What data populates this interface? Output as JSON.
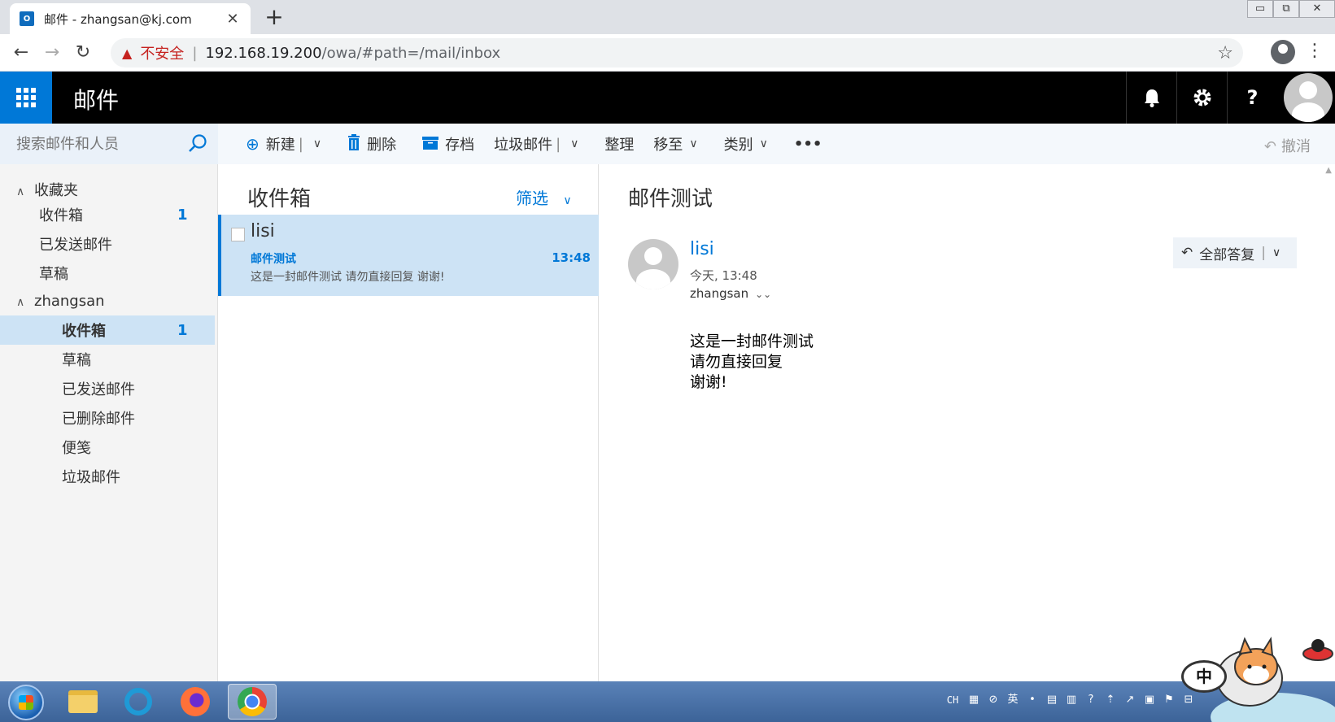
{
  "browser": {
    "tab_title": "邮件 - zhangsan@kj.com",
    "tab_favicon": "O",
    "new_tab": "+",
    "window_controls": [
      "▭",
      "⧉",
      "✕"
    ],
    "security_label": "不安全",
    "url_host": "192.168.19.200",
    "url_path": "/owa/#path=/mail/inbox"
  },
  "header": {
    "app_title": "邮件",
    "icons": [
      "bell-icon",
      "gear-icon",
      "help-icon",
      "avatar"
    ],
    "help_glyph": "?"
  },
  "search": {
    "placeholder": "搜索邮件和人员"
  },
  "commands": {
    "new": "新建",
    "delete": "删除",
    "archive": "存档",
    "junk": "垃圾邮件",
    "sweep": "整理",
    "move": "移至",
    "categorize": "类别",
    "more": "•••",
    "undo": "撤消"
  },
  "folders": {
    "favorites_label": "收藏夹",
    "favorites": [
      {
        "label": "收件箱",
        "count": "1"
      },
      {
        "label": "已发送邮件",
        "count": ""
      },
      {
        "label": "草稿",
        "count": ""
      }
    ],
    "account_label": "zhangsan",
    "account": [
      {
        "label": "收件箱",
        "count": "1"
      },
      {
        "label": "草稿",
        "count": ""
      },
      {
        "label": "已发送邮件",
        "count": ""
      },
      {
        "label": "已删除邮件",
        "count": ""
      },
      {
        "label": "便笺",
        "count": ""
      },
      {
        "label": "垃圾邮件",
        "count": ""
      }
    ]
  },
  "list": {
    "title": "收件箱",
    "filter": "筛选",
    "messages": [
      {
        "from": "lisi",
        "subject": "邮件测试",
        "time": "13:48",
        "preview": "这是一封邮件测试 请勿直接回复 谢谢!"
      }
    ]
  },
  "reading": {
    "subject": "邮件测试",
    "from": "lisi",
    "date": "今天, 13:48",
    "to": "zhangsan",
    "reply_all": "全部答复",
    "body": [
      "这是一封邮件测试",
      "请勿直接回复",
      "谢谢!"
    ]
  },
  "taskbar": {
    "lang": "CH",
    "ime": "中"
  },
  "colors": {
    "accent": "#0078d7",
    "selected": "#cde3f5",
    "header": "#000000"
  }
}
